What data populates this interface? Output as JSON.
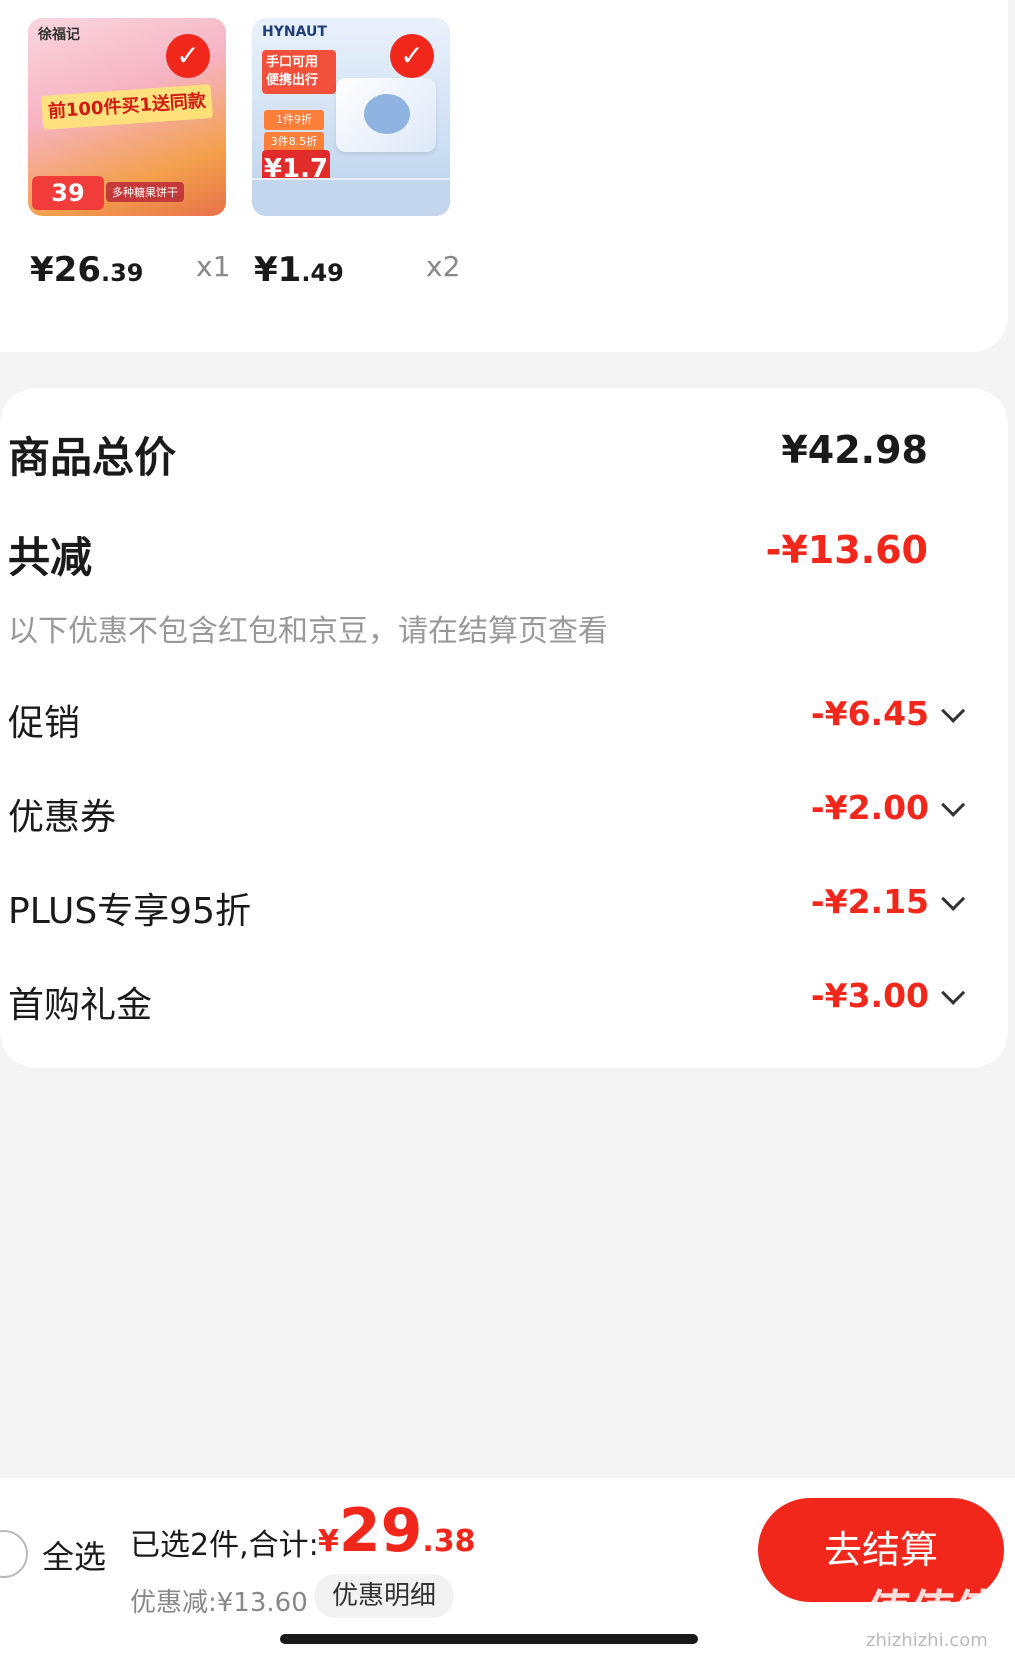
{
  "products": [
    {
      "image_label": "徐福记",
      "image_banner": "前100件买1送同款",
      "image_price": "39",
      "image_note": "多种糖果饼干",
      "price_int": "¥26",
      "price_dec": ".39",
      "qty": "x1"
    },
    {
      "image_label": "HYNAUT",
      "image_badge": "手口可用 便携出行",
      "image_tag1": "1件9折",
      "image_tag2": "3件8.5折",
      "image_price": "¥1.7",
      "price_int": "¥1",
      "price_dec": ".49",
      "qty": "x2"
    }
  ],
  "summary": {
    "total_label": "商品总价",
    "total_value": "¥42.98",
    "reduce_label": "共减",
    "reduce_value": "-¥13.60",
    "hint": "以下优惠不包含红包和京豆，请在结算页查看",
    "items": [
      {
        "label": "促销",
        "value": "-¥6.45"
      },
      {
        "label": "优惠券",
        "value": "-¥2.00"
      },
      {
        "label": "PLUS专享95折",
        "value": "-¥2.15"
      },
      {
        "label": "首购礼金",
        "value": "-¥3.00"
      }
    ]
  },
  "bottom": {
    "select_all": "全选",
    "selected_text": "已选2件,合计:",
    "total_currency": "¥",
    "total_int": "29",
    "total_dec": ".38",
    "discount_text": "优惠减:¥13.60",
    "detail_button": "优惠明细",
    "checkout_button": "去结算"
  },
  "watermark": {
    "main": "值值值",
    "sub": "zhizhizhi.com"
  },
  "colors": {
    "accent_red": "#f2271c",
    "background": "#f4f4f4"
  }
}
